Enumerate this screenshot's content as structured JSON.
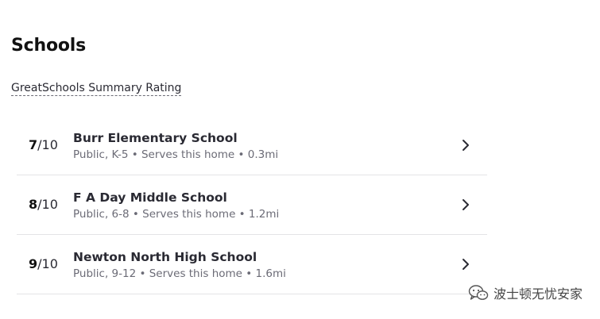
{
  "section": {
    "title": "Schools",
    "summary_link": "GreatSchools Summary Rating"
  },
  "schools": [
    {
      "score": "7",
      "out_of": "/10",
      "name": "Burr Elementary School",
      "details": "Public, K-5 • Serves this home • 0.3mi"
    },
    {
      "score": "8",
      "out_of": "/10",
      "name": "F A Day Middle School",
      "details": "Public, 6-8 • Serves this home • 1.2mi"
    },
    {
      "score": "9",
      "out_of": "/10",
      "name": "Newton North High School",
      "details": "Public, 9-12 • Serves this home • 1.6mi"
    }
  ],
  "icons": {
    "row_action": "chevron-right-icon",
    "watermark": "wechat-icon"
  },
  "watermark": {
    "text": "波士顿无忧安家"
  },
  "colors": {
    "primary_text": "#2a2a33",
    "secondary_text": "#6b6b76",
    "divider": "#e4e4e6"
  }
}
